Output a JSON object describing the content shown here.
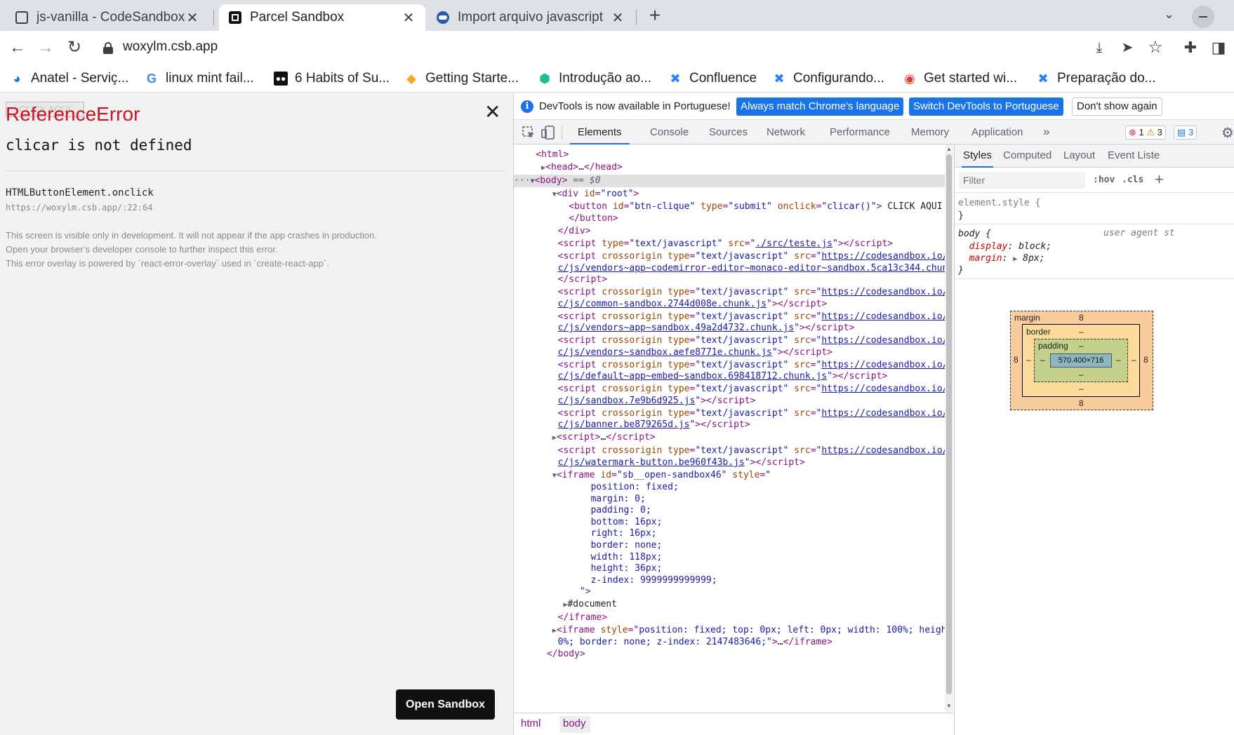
{
  "browser": {
    "tabs": [
      {
        "title": "js-vanilla - CodeSandbox",
        "icon": "sandbox-icon"
      },
      {
        "title": "Parcel Sandbox",
        "icon": "sandbox-dark-icon"
      },
      {
        "title": "Import arquivo javascript",
        "icon": "site-icon"
      }
    ],
    "new_tab": "+",
    "url": "woxylm.csb.app",
    "bookmarks": [
      "Anatel - Serviç...",
      "linux mint fail...",
      "6 Habits of Su...",
      "Getting Starte...",
      "Introdução ao...",
      "Confluence",
      "Configurando...",
      "Get started wi...",
      "Preparação do..."
    ]
  },
  "app": {
    "button_label": "CLICK AQUI",
    "error_title": "ReferenceError",
    "error_message": "clicar is not defined",
    "stack_fn": "HTMLButtonElement.onclick",
    "stack_loc": "https://woxylm.csb.app/:22:64",
    "notes": [
      "This screen is visible only in development. It will not appear if the app crashes in production.",
      "Open your browser’s developer console to further inspect this error.",
      "This error overlay is powered by `react-error-overlay` used in `create-react-app`."
    ],
    "open_sandbox": "Open Sandbox"
  },
  "devtools": {
    "infobar": {
      "text": "DevTools is now available in Portuguese!",
      "btn_match": "Always match Chrome's language",
      "btn_switch": "Switch DevTools to Portuguese",
      "btn_dismiss": "Don't show again"
    },
    "tabs": [
      "Elements",
      "Console",
      "Sources",
      "Network",
      "Performance",
      "Memory",
      "Application"
    ],
    "more": "»",
    "counts": {
      "errors": "1",
      "warnings": "3",
      "messages": "3"
    },
    "breadcrumbs": [
      "html",
      "body"
    ],
    "side_tabs": [
      "Styles",
      "Computed",
      "Layout",
      "Event Liste"
    ],
    "filter_placeholder": "Filter",
    "hov": ":hov",
    "cls": ".cls",
    "rules": {
      "element_style": "element.style {",
      "close": "}",
      "body_selector": "body {",
      "user_agent": "user agent st",
      "display_prop": "display",
      "display_val": "block;",
      "margin_prop": "margin",
      "margin_val": "8px;"
    },
    "box_model": {
      "margin_label": "margin",
      "border_label": "border",
      "padding_label": "padding",
      "margin_top": "8",
      "margin_bottom": "8",
      "margin_left": "8",
      "margin_right": "8",
      "border_val": "–",
      "padding_val": "–",
      "content": "570.400×716"
    }
  }
}
